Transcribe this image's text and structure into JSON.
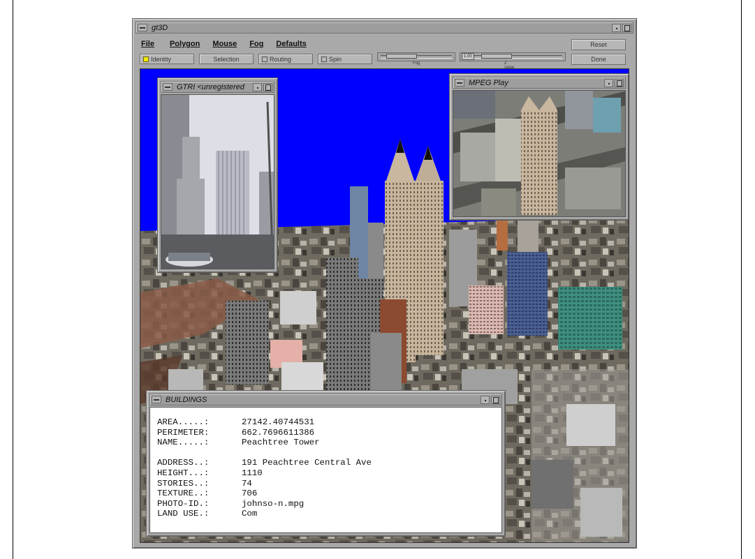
{
  "main_window": {
    "title": "gt3D",
    "menu": [
      "File",
      "Polygon",
      "Mouse",
      "Fog",
      "Defaults"
    ],
    "toolbar": {
      "identity": "Identity",
      "selection": "Selection",
      "routing": "Routing",
      "spin": "Spin",
      "fog_label": "Fog",
      "zvalue_label": "Z value",
      "zvalue_readout": "1.00",
      "reset": "Reset",
      "done": "Done"
    }
  },
  "gtri_window": {
    "title": "GTRI <unregistered"
  },
  "mpeg_window": {
    "title": "MPEG Play"
  },
  "buildings_window": {
    "title": "BUILDINGS",
    "group1": [
      {
        "key": "AREA.....:",
        "value": "27142.40744531"
      },
      {
        "key": "PERIMETER:",
        "value": "662.7696611386"
      },
      {
        "key": "NAME.....:",
        "value": "Peachtree Tower"
      }
    ],
    "group2": [
      {
        "key": "ADDRESS..:",
        "value": "191 Peachtree Central Ave"
      },
      {
        "key": "HEIGHT...:",
        "value": "1110"
      },
      {
        "key": "STORIES..:",
        "value": "74"
      },
      {
        "key": "TEXTURE..:",
        "value": "706"
      },
      {
        "key": "PHOTO-ID.:",
        "value": "johnso-n.mpg"
      },
      {
        "key": "LAND USE.:",
        "value": "Com"
      }
    ]
  },
  "colors": {
    "sky": "#0000ff",
    "window_gray": "#a9a9a9",
    "identity_indicator": "#f2e800",
    "tower": "#c9b7a0"
  }
}
